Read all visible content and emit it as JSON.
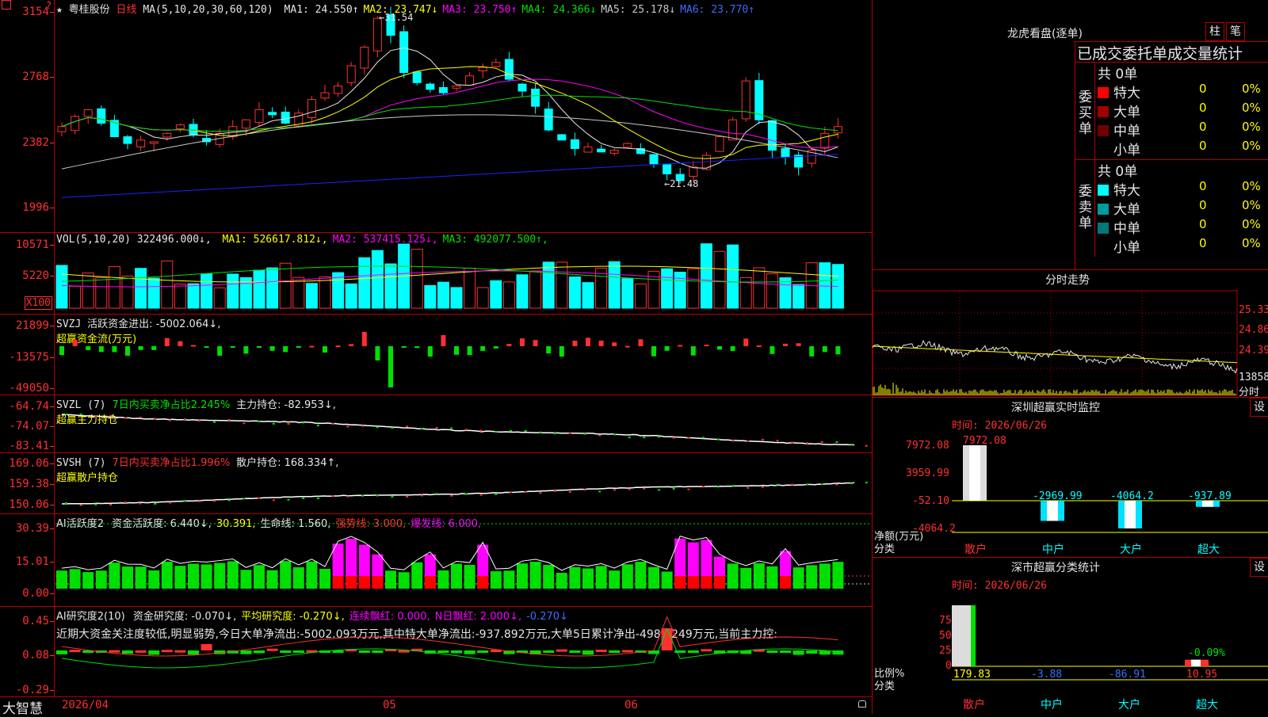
{
  "main": {
    "stock": "粤桂股份",
    "period": "日线",
    "ma_def": "MA(5,10,20,30,60,120)",
    "ma": [
      {
        "label": "MA1:",
        "value": "24.550",
        "arrow": "↑",
        "color": "#e6e6e6"
      },
      {
        "label": "MA2:",
        "value": "23.747",
        "arrow": "↓",
        "color": "#ffff00"
      },
      {
        "label": "MA3:",
        "value": "23.750",
        "arrow": "↑",
        "color": "#ff00ff"
      },
      {
        "label": "MA4:",
        "value": "24.366",
        "arrow": "↓",
        "color": "#00e000"
      },
      {
        "label": "MA5:",
        "value": "25.178",
        "arrow": "↓",
        "color": "#c8c8c8"
      },
      {
        "label": "MA6:",
        "value": "23.770",
        "arrow": "↑",
        "color": "#3c6cff"
      }
    ],
    "yticks": [
      "3154",
      "2768",
      "2382",
      "1996"
    ],
    "high_label": "31.54",
    "low_label": "21.48",
    "colors": {
      "up": "#ff3030",
      "down": "#00ffff",
      "ma1": "#e6e6e6",
      "ma2": "#ffff00",
      "ma3": "#ff00ff",
      "ma4": "#00e000",
      "ma5": "#c8c8c8",
      "ma6": "#2020ff"
    }
  },
  "vol": {
    "def": "VOL(5,10,20)",
    "value": "322496.000",
    "ma": [
      {
        "label": "MA1:",
        "value": "526617.812",
        "arrow": "↓",
        "color": "#ffff00"
      },
      {
        "label": "MA2:",
        "value": "537415.125",
        "arrow": "↓",
        "color": "#ff00ff"
      },
      {
        "label": "MA3:",
        "value": "492077.500",
        "arrow": "↑",
        "color": "#00e000"
      }
    ],
    "yticks": [
      "10571",
      "5220"
    ],
    "unit": "X100"
  },
  "svzj": {
    "title": "SVZJ",
    "line1": "活跃资金进出: -5002.064↓,",
    "line2": "超赢资金流(万元)",
    "yticks": [
      "21899",
      "-13575",
      "-49050"
    ]
  },
  "svzl": {
    "title": "SVZL (7)",
    "ratio": "7日内买卖净占比2.245%",
    "hold": "主力持仓: -82.953↓,",
    "line2": "超赢主力持仓",
    "yticks": [
      "-64.74",
      "-74.07",
      "-83.41"
    ]
  },
  "svsh": {
    "title": "SVSH (7)",
    "ratio": "7日内买卖净占比1.996%",
    "hold": "散户持仓: 168.334↑,",
    "line2": "超赢散户持仓",
    "yticks": [
      "169.06",
      "159.38",
      "150.06"
    ]
  },
  "ai1": {
    "title": "AI活跃度2",
    "parts": [
      {
        "t": "资金活跃度: 6.440↓,",
        "c": "#e6e6e6"
      },
      {
        "t": "30.391,",
        "c": "#ffff00"
      },
      {
        "t": "生命线: 1.560,",
        "c": "#e6e6e6"
      },
      {
        "t": "强势线: 3.000,",
        "c": "#ff3030"
      },
      {
        "t": "爆发线: 6.000,",
        "c": "#ff00ff"
      }
    ],
    "yticks": [
      "30.39",
      "15.01",
      "0.00"
    ]
  },
  "ai2": {
    "title": "AI研究度2(10)",
    "parts": [
      {
        "t": "资金研究度: -0.070↓,",
        "c": "#e6e6e6"
      },
      {
        "t": "平均研究度: -0.270↓,",
        "c": "#ffff00"
      },
      {
        "t": "连续飘红: 0.000,",
        "c": "#ff00ff"
      },
      {
        "t": "N日飘红: 2.000↓,",
        "c": "#ff00ff"
      },
      {
        "t": "-0.270↓",
        "c": "#3c6cff"
      }
    ],
    "comment": "近期大资金关注度较低,明显弱势,今日大单净流出:-5002.093万元,其中特大单净流出:-937.892万元,大单5日累计净出-4983.249万元,当前主力控:",
    "yticks": [
      "0.45",
      "0.08",
      "-0.29"
    ]
  },
  "bottom": {
    "logo": "大智慧",
    "d1": "2026/04",
    "d2": "05",
    "d3": "06"
  },
  "lhb": {
    "title": "龙虎看盘(逐单)",
    "btn1": "柱",
    "btn2": "笔",
    "subtitle": "已成交委托单成交量统计",
    "buy": {
      "label": [
        "委",
        "买",
        "单"
      ],
      "total": "共 0单",
      "rows": [
        {
          "name": "特大",
          "count": "0",
          "pct": "0%",
          "color": "#ff0000"
        },
        {
          "name": "大单",
          "count": "0",
          "pct": "0%",
          "color": "#a00000"
        },
        {
          "name": "中单",
          "count": "0",
          "pct": "0%",
          "color": "#700000"
        },
        {
          "name": "小单",
          "count": "0",
          "pct": "0%",
          "color": ""
        }
      ]
    },
    "sell": {
      "label": [
        "委",
        "卖",
        "单"
      ],
      "total": "共 0单",
      "rows": [
        {
          "name": "特大",
          "count": "0",
          "pct": "0%",
          "color": "#00ffff"
        },
        {
          "name": "大单",
          "count": "0",
          "pct": "0%",
          "color": "#009c9c"
        },
        {
          "name": "中单",
          "count": "0",
          "pct": "0%",
          "color": "#007878"
        },
        {
          "name": "小单",
          "count": "0",
          "pct": "0%",
          "color": ""
        }
      ]
    }
  },
  "fs": {
    "title": "分时走势",
    "yticks": [
      "25.33",
      "24.86",
      "24.39"
    ],
    "vol": "13858",
    "unit": "分时"
  },
  "szmon": {
    "title": "深圳超赢实时监控",
    "btn": "设",
    "time": "时间: 2026/06/26",
    "yticks": [
      "7972.08",
      "3959.99",
      "-52.10",
      "-4064.2"
    ],
    "ylabel1": "净额(万元)",
    "ylabel2": "分类",
    "chart_data": {
      "type": "bar",
      "categories": [
        "散户",
        "中户",
        "大户",
        "超大"
      ],
      "values": [
        7972.08,
        -2969.99,
        -4064.2,
        -937.89
      ],
      "value_labels": [
        "7972.08",
        "-2969.99",
        "-4064.2",
        "-937.89"
      ],
      "ylim": [
        -4064.2,
        7972.08
      ]
    }
  },
  "szcls": {
    "title": "深市超赢分类统计",
    "btn": "设",
    "time": "时间: 2026/06/26",
    "yticks": [
      "75",
      "50",
      "25",
      "0"
    ],
    "ylabel1": "比例%",
    "ylabel2": "分类",
    "chart_data": {
      "type": "bar",
      "categories": [
        "散户",
        "中户",
        "大户",
        "超大"
      ],
      "values": [
        179.83,
        -3.88,
        -86.91,
        10.95
      ],
      "value_labels": [
        "179.83",
        "-3.88",
        "-86.91",
        "10.95"
      ],
      "extra_label": "-0.09%",
      "ylim": [
        0,
        75
      ]
    }
  }
}
